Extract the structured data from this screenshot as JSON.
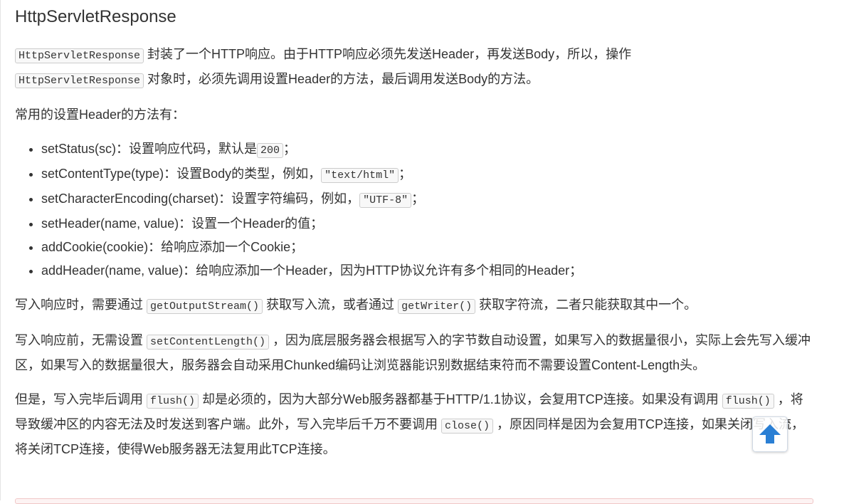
{
  "title": "HttpServletResponse",
  "intro": {
    "code1": "HttpServletResponse",
    "text1": "封装了一个HTTP响应。由于HTTP响应必须先发送Header，再发送Body，所以，操作",
    "code2": "HttpServletResponse",
    "text2": "对象时，必须先调用设置Header的方法，最后调用发送Body的方法。"
  },
  "methods_heading": "常用的设置Header的方法有：",
  "methods": {
    "set_status": {
      "text": "setStatus(sc)：设置响应代码，默认是",
      "code": "200",
      "suffix": "；"
    },
    "set_content_type": {
      "text": "setContentType(type)：设置Body的类型，例如，",
      "code": "\"text/html\"",
      "suffix": "；"
    },
    "set_character_encoding": {
      "text": "setCharacterEncoding(charset)：设置字符编码，例如，",
      "code": "\"UTF-8\"",
      "suffix": "；"
    },
    "set_header": {
      "text": "setHeader(name, value)：设置一个Header的值；"
    },
    "add_cookie": {
      "text": "addCookie(cookie)：给响应添加一个Cookie；"
    },
    "add_header": {
      "text": "addHeader(name, value)：给响应添加一个Header，因为HTTP协议允许有多个相同的Header；"
    }
  },
  "write_response": {
    "text1": "写入响应时，需要通过",
    "code1": "getOutputStream()",
    "text2": "获取写入流，或者通过",
    "code2": "getWriter()",
    "text3": "获取字符流，二者只能获取其中一个。"
  },
  "content_length": {
    "text1": "写入响应前，无需设置",
    "code1": "setContentLength()",
    "text2": "，因为底层服务器会根据写入的字节数自动设置，如果写入的数据量很小，实际上会先写入缓冲区，如果写入的数据量很大，服务器会自动采用Chunked编码让浏览器能识别数据结束符而不需要设置Content-Length头。"
  },
  "flush": {
    "text1": "但是，写入完毕后调用",
    "code1": "flush()",
    "text2": "却是必须的，因为大部分Web服务器都基于HTTP/1.1协议，会复用TCP连接。如果没有调用",
    "code2": "flush()",
    "text3": "，将导致缓冲区的内容无法及时发送到客户端。此外，写入完毕后千万不要调用",
    "code3": "close()",
    "text4": "，原因同样是因为会复用TCP连接，如果关闭写入流，将关闭TCP连接，使得Web服务器无法复用此TCP连接。"
  },
  "back_to_top": {
    "icon": "arrow-up-icon",
    "color": "#2a7fd4"
  }
}
